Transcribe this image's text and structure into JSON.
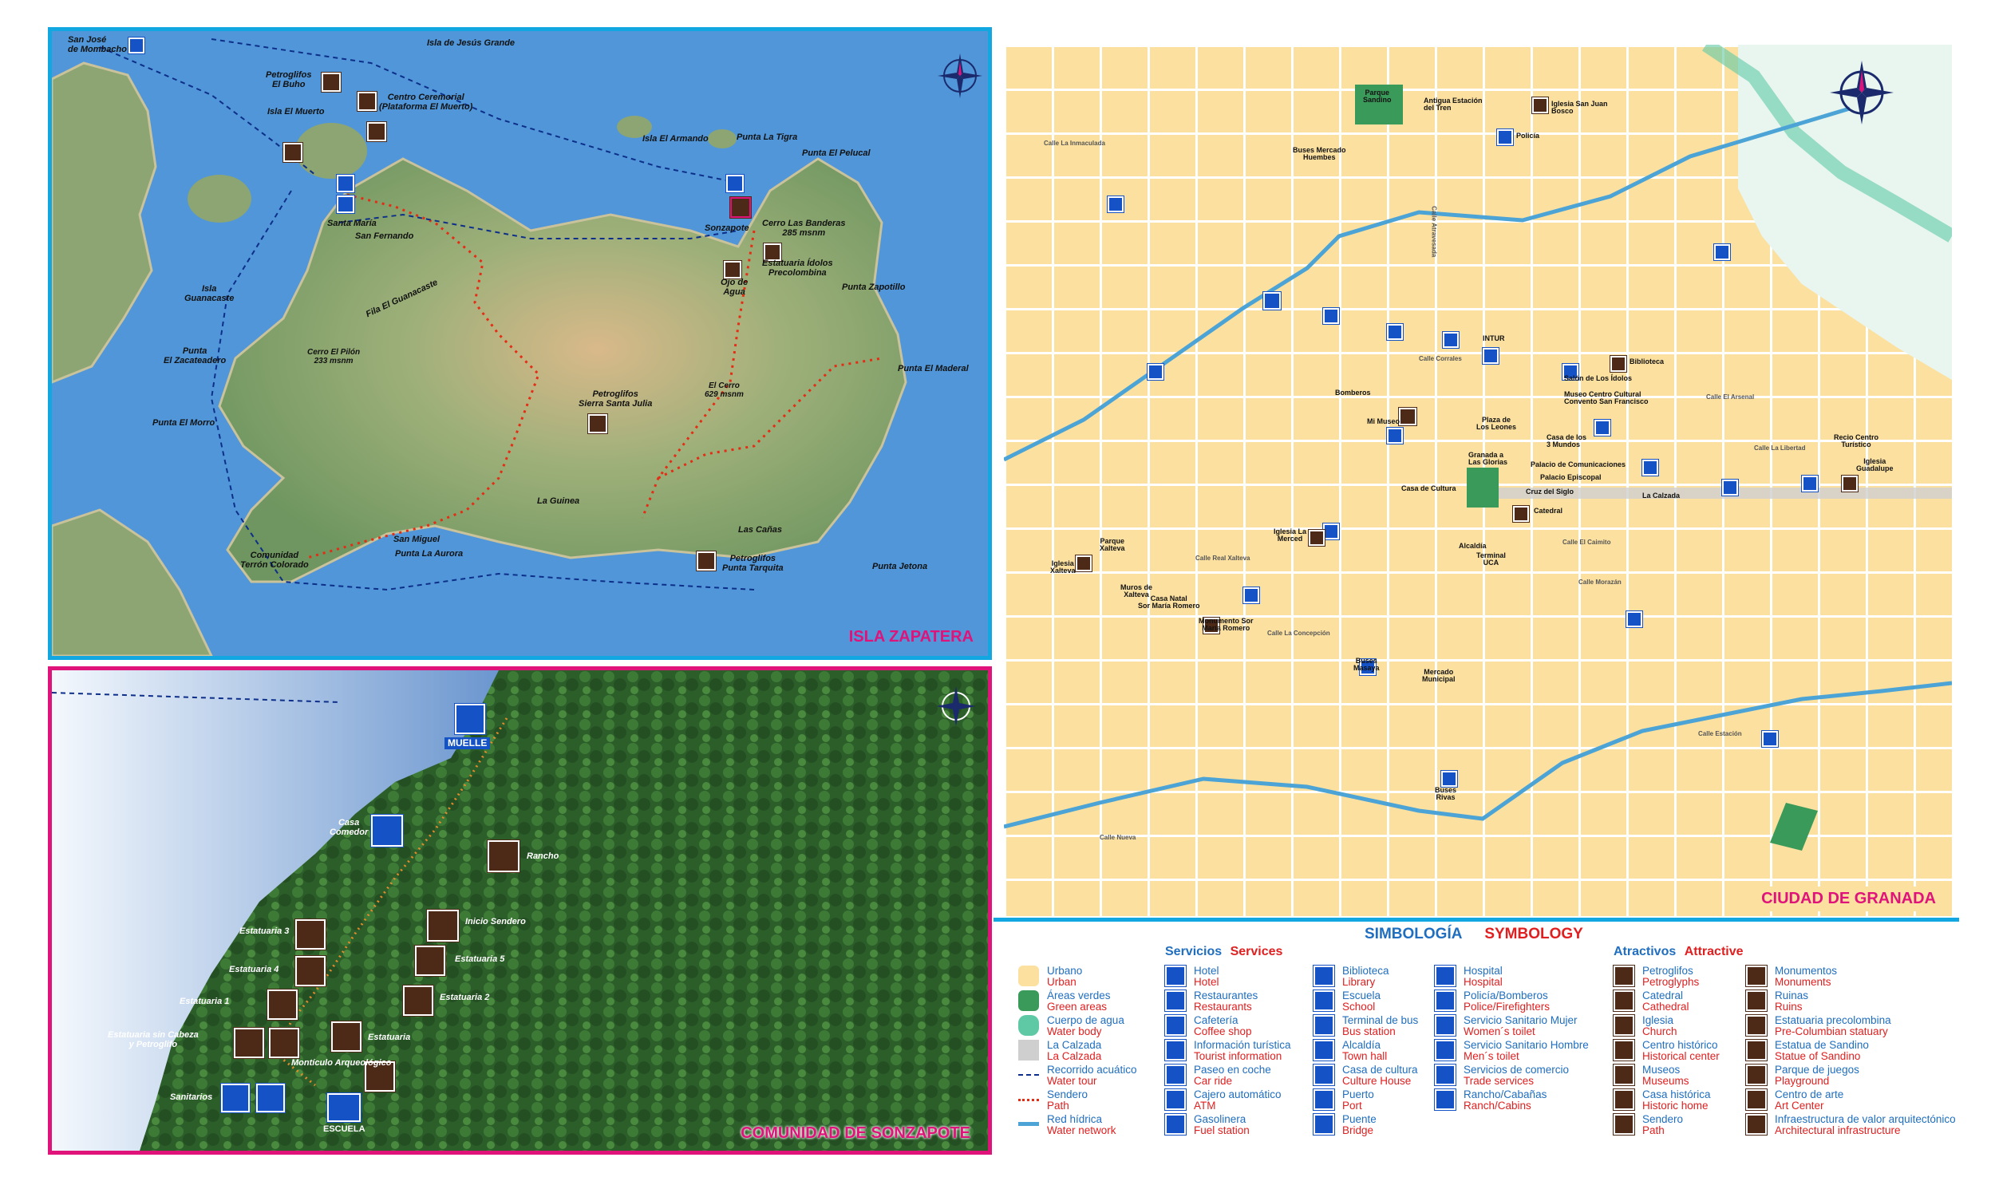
{
  "zapatera": {
    "title": "ISLA ZAPATERA",
    "labels": {
      "san_jose": "San José\nde Mombacho",
      "isla_jesus": "Isla de Jesús Grande",
      "petroglifos_buho": "Petroglifos\nEl Buho",
      "centro_ceremorial": "Centro Ceremorial\n(Plataforma El Muerto)",
      "isla_muerto": "Isla El Muerto",
      "isla_armando": "Isla El Armando",
      "punta_tigra": "Punta La Tigra",
      "punta_pelucal": "Punta El Pelucal",
      "santa_maria": "Santa María",
      "san_fernando": "San Fernando",
      "sonzapote": "Sonzapote",
      "cerro_banderas": "Cerro Las Banderas\n285 msnm",
      "estatuaria": "Estatuaria Ídolos\nPrecolombina",
      "ojo_agua": "Ojo de\nAgua",
      "isla_guanacaste": "Isla\nGuanacaste",
      "fila_guanacaste": "Fila El Guanacaste",
      "punta_zapotillo": "Punta Zapotillo",
      "punta_zacateadero": "Punta\nEl Zacateadero",
      "cerro_pilon": "Cerro El Pilón\n233 msnm",
      "punta_madera": "Punta El Maderal",
      "punta_morro": "Punta El Morro",
      "el_cerro": "El Cerro\n629 msnm",
      "petroglifos_sierra": "Petroglifos\nSierra Santa Julia",
      "la_guinea": "La Guinea",
      "las_canas": "Las Cañas",
      "san_miguel": "San Miguel",
      "punta_aurora": "Punta La Aurora",
      "comunidad_terron": "Comunidad\nTerrón Colorado",
      "petroglifos_tarquita": "Petroglifos\nPunta Tarquita",
      "punta_jetona": "Punta Jetona"
    }
  },
  "sonzapote": {
    "title": "COMUNIDAD DE SONZAPOTE",
    "labels": {
      "muelle": "MUELLE",
      "casa_comedor": "Casa\nComedor",
      "rancho": "Rancho",
      "inicio_sendero": "Inicio Sendero",
      "estatuaria3": "Estatuaria 3",
      "estatuaria4": "Estatuaria 4",
      "estatuaria5": "Estatuaria 5",
      "estatuaria1": "Estatuaria 1",
      "estatuaria2": "Estatuaria 2",
      "sin_cabeza": "Estatuaria sin Cabeza\ny Petroglifo",
      "estatuaria": "Estatuaria",
      "monticulo": "Montículo Arqueológico",
      "sanitarios": "Sanitarios",
      "escuela": "ESCUELA"
    }
  },
  "granada": {
    "title": "CIUDAD DE GRANADA",
    "labels": {
      "parque_sandino": "Parque\nSandino",
      "antigua_estacion": "Antigua Estación\ndel Tren",
      "iglesia_san_juan": "Iglesia San Juan\nBosco",
      "policia": "Policía",
      "buses_huembes": "Buses Mercado\nHuembes",
      "biblioteca": "Biblioteca",
      "salon_idolos": "Salón de Los Ídolos",
      "museo_convento": "Museo Centro Cultural\nConvento San Francisco",
      "bomberos": "Bomberos",
      "mi_museo": "Mi Museo",
      "plaza_leones": "Plaza de\nLos Leones",
      "casa_mundos": "Casa de los\n3 Mundos",
      "granada_glorias": "Granada a\nLas Glorias",
      "palacio_com": "Palacio de Comunicaciones",
      "palacio_epi": "Palacio Episcopal",
      "casa_cultura": "Casa de Cultura",
      "cruz_siglo": "Cruz del Siglo",
      "catedral": "Catedral",
      "iglesia_merced": "Iglesia La\nMerced",
      "recio": "Recio Centro\nTurístico",
      "iglesia_guadalupe": "Iglesia\nGuadalupe",
      "parque_xalteva": "Parque\nXalteva",
      "iglesia_xalteva": "Iglesia\nXalteva",
      "muros_xalteva": "Muros de\nXalteva",
      "casa_natal": "Casa Natal\nSor María Romero",
      "monumento_sor": "Monumento Sor\nMaría Romero",
      "alcaldia": "Alcaldía",
      "terminal_uca": "Terminal\nUCA",
      "buses_masaya": "Buses\nMasaya",
      "mercado": "Mercado\nMunicipal",
      "buses_rivas": "Buses\nRivas",
      "intur": "INTUR",
      "la_calzada": "La Calzada",
      "calle_libertad": "Calle La Libertad",
      "calle_real": "Calle Real Xalteva",
      "calle_atravesada": "Calle Atravesada",
      "calle_inmaculada": "Calle La Inmaculada",
      "calle_arsenal": "Calle El Arsenal",
      "calle_caimito": "Calle El Caimito",
      "calle_corrales": "Calle Corrales",
      "calle_concepcion": "Calle La Concepción",
      "calle_morazan": "Calle Morazán",
      "calle_estacion": "Calle Estación",
      "calle_nueva": "Calle Nueva"
    }
  },
  "legend": {
    "heading_es": "SIMBOLOGÍA",
    "heading_en": "SYMBOLOGY",
    "servicios_es": "Servicios",
    "servicios_en": "Services",
    "atractivos_es": "Atractivos",
    "atractivos_en": "Attractive",
    "col0": [
      {
        "es": "Urbano",
        "en": "Urban",
        "icon": "urban-swatch"
      },
      {
        "es": "Áreas verdes",
        "en": "Green areas",
        "icon": "green-swatch"
      },
      {
        "es": "Cuerpo de agua",
        "en": "Water body",
        "icon": "water-swatch"
      },
      {
        "es": "La Calzada",
        "en": "La Calzada",
        "icon": "calzada-swatch"
      },
      {
        "es": "Recorrido acuático",
        "en": "Water tour",
        "icon": "water-tour-line"
      },
      {
        "es": "Sendero",
        "en": "Path",
        "icon": "path-line"
      },
      {
        "es": "Red hídrica",
        "en": "Water network",
        "icon": "water-network-line"
      }
    ],
    "col1": [
      {
        "es": "Hotel",
        "en": "Hotel",
        "icon": "hotel-icon"
      },
      {
        "es": "Restaurantes",
        "en": "Restaurants",
        "icon": "restaurant-icon"
      },
      {
        "es": "Cafetería",
        "en": "Coffee shop",
        "icon": "coffee-icon"
      },
      {
        "es": "Información turística",
        "en": "Tourist information",
        "icon": "info-icon"
      },
      {
        "es": "Paseo en coche",
        "en": "Car ride",
        "icon": "carriage-icon"
      },
      {
        "es": "Cajero automático",
        "en": "ATM",
        "icon": "atm-icon"
      },
      {
        "es": "Gasolinera",
        "en": "Fuel station",
        "icon": "fuel-icon"
      }
    ],
    "col2": [
      {
        "es": "Biblioteca",
        "en": "Library",
        "icon": "library-icon"
      },
      {
        "es": "Escuela",
        "en": "School",
        "icon": "school-icon"
      },
      {
        "es": "Terminal de bus",
        "en": "Bus station",
        "icon": "bus-icon"
      },
      {
        "es": "Alcaldía",
        "en": "Town hall",
        "icon": "townhall-icon"
      },
      {
        "es": "Casa de cultura",
        "en": "Culture House",
        "icon": "culture-icon"
      },
      {
        "es": "Puerto",
        "en": "Port",
        "icon": "port-icon"
      },
      {
        "es": "Puente",
        "en": "Bridge",
        "icon": "bridge-icon"
      }
    ],
    "col3": [
      {
        "es": "Hospital",
        "en": "Hospital",
        "icon": "hospital-icon"
      },
      {
        "es": "Policía/Bomberos",
        "en": "Police/Firefighters",
        "icon": "police-icon"
      },
      {
        "es": "Servicio Sanitario Mujer",
        "en": "Women´s toilet",
        "icon": "women-toilet-icon"
      },
      {
        "es": "Servicio Sanitario Hombre",
        "en": "Men´s toilet",
        "icon": "men-toilet-icon"
      },
      {
        "es": "Servicios de comercio",
        "en": "Trade services",
        "icon": "trade-icon"
      },
      {
        "es": "Rancho/Cabañas",
        "en": "Ranch/Cabins",
        "icon": "ranch-icon"
      }
    ],
    "col4": [
      {
        "es": "Petroglifos",
        "en": "Petroglyphs",
        "icon": "petroglyph-icon"
      },
      {
        "es": "Catedral",
        "en": "Cathedral",
        "icon": "cathedral-icon"
      },
      {
        "es": "Iglesia",
        "en": "Church",
        "icon": "church-icon"
      },
      {
        "es": "Centro histórico",
        "en": "Historical center",
        "icon": "historic-center-icon"
      },
      {
        "es": "Museos",
        "en": "Museums",
        "icon": "museum-icon"
      },
      {
        "es": "Casa histórica",
        "en": "Historic home",
        "icon": "historic-home-icon"
      },
      {
        "es": "Sendero",
        "en": "Path",
        "icon": "hiker-icon"
      }
    ],
    "col5": [
      {
        "es": "Monumentos",
        "en": "Monuments",
        "icon": "monument-icon"
      },
      {
        "es": "Ruinas",
        "en": "Ruins",
        "icon": "ruins-icon"
      },
      {
        "es": "Estatuaria precolombina",
        "en": "Pre-Columbian statuary",
        "icon": "statue-icon"
      },
      {
        "es": "Estatua de Sandino",
        "en": "Statue of Sandino",
        "icon": "sandino-icon"
      },
      {
        "es": "Parque de juegos",
        "en": "Playground",
        "icon": "playground-icon"
      },
      {
        "es": "Centro de arte",
        "en": "Art Center",
        "icon": "art-icon"
      },
      {
        "es": "Infraestructura de valor arquitectónico",
        "en": "Architectural infrastructure",
        "icon": "architecture-icon"
      }
    ]
  }
}
